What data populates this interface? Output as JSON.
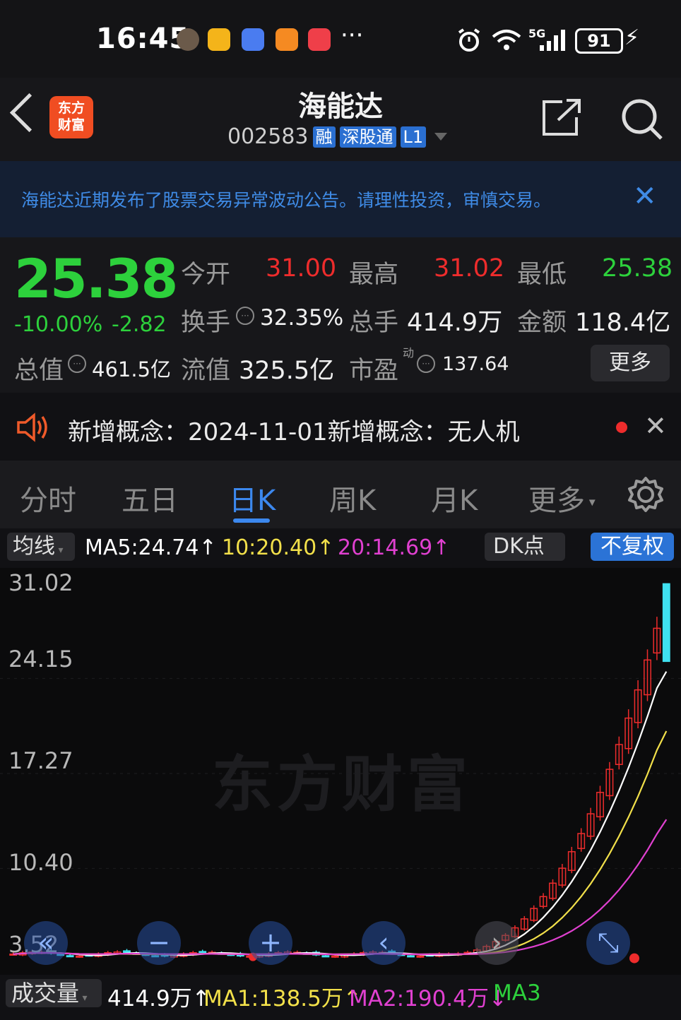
{
  "status_bar": {
    "time": "16:45",
    "signal": "5G",
    "battery": "91"
  },
  "header": {
    "logo_line1": "东方",
    "logo_line2": "财富",
    "title": "海能达",
    "code": "002583",
    "tags": [
      "融",
      "深股通",
      "L1"
    ]
  },
  "notice": {
    "text": "海能达近期发布了股票交易异常波动公告。请理性投资，审慎交易。"
  },
  "quote": {
    "price": "25.38",
    "change_pct": "-10.00%",
    "change_abs": "-2.82",
    "open_label": "今开",
    "open_value": "31.00",
    "high_label": "最高",
    "high_value": "31.02",
    "low_label": "最低",
    "low_value": "25.38",
    "turnover_label": "换手",
    "turnover_value": "32.35%",
    "volume_label": "总手",
    "volume_value": "414.9万",
    "amount_label": "金额",
    "amount_value": "118.4亿",
    "mktcap_label": "总值",
    "mktcap_value": "461.5亿",
    "float_label": "流值",
    "float_value": "325.5亿",
    "pe_label": "市盈",
    "pe_sup": "动",
    "pe_value": "137.64",
    "more_label": "更多"
  },
  "concept": {
    "text": "新增概念：2024-11-01新增概念：无人机"
  },
  "tabs": [
    "分时",
    "五日",
    "日K",
    "周K",
    "月K",
    "更多"
  ],
  "active_tab": "日K",
  "ma_row": {
    "select_label": "均线",
    "ma5": "MA5:24.74↑",
    "ma10": "10:20.40↑",
    "ma20": "20:14.69↑",
    "dk_label": "DK点",
    "adjust_label": "不复权",
    "colors": {
      "ma5": "#ffffff",
      "ma10": "#f2e04a",
      "ma20": "#e040d0"
    }
  },
  "chart_data": {
    "type": "candlestick",
    "y_ticks": [
      "31.02",
      "24.15",
      "17.27",
      "10.40",
      "3.52"
    ],
    "ylim": [
      3.52,
      31.02
    ],
    "latest_close": 25.38,
    "latest_high": 31.02,
    "latest_open": 31.0,
    "latest_low": 25.38
  },
  "volume_row": {
    "select_label": "成交量",
    "vol": "414.9万↑",
    "ma1": "MA1:138.5万↑",
    "ma2": "MA2:190.4万↓",
    "ma3": "MA3",
    "colors": {
      "ma1": "#f2e04a",
      "ma2": "#e040d0",
      "ma3": "#2dd13c"
    }
  }
}
